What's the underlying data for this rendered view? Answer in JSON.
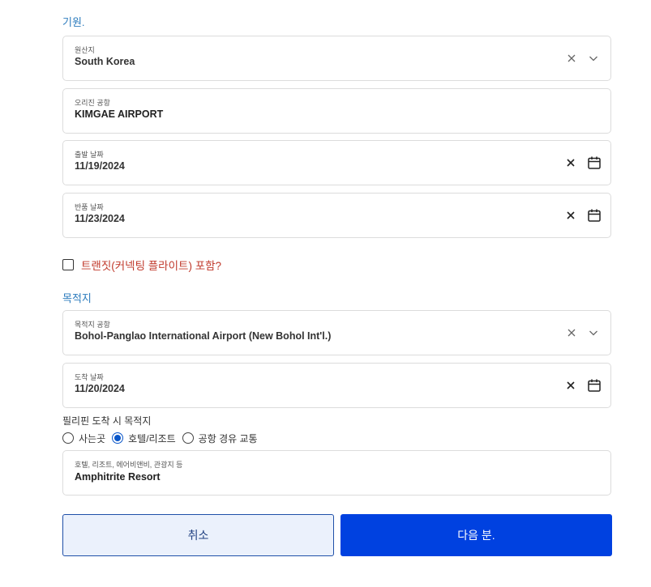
{
  "origin": {
    "section_title": "기원.",
    "country": {
      "label": "원산지",
      "value": "South Korea"
    },
    "airport": {
      "label": "오리진 공항",
      "value": "KIMGAE AIRPORT"
    },
    "departure": {
      "label": "출발 날짜",
      "value": "11/19/2024"
    },
    "return": {
      "label": "반품 날짜",
      "value": "11/23/2024"
    }
  },
  "transit": {
    "label": "트랜짓(커넥팅 플라이트) 포함?",
    "checked": false
  },
  "destination": {
    "section_title": "목적지",
    "airport": {
      "label": "목적지 공항",
      "value": "Bohol-Panglao International Airport (New Bohol Int'l.)"
    },
    "arrival": {
      "label": "도착 날짜",
      "value": "11/20/2024"
    },
    "question": "필리핀 도착 시 목적지",
    "options": [
      {
        "label": "사는곳",
        "checked": false
      },
      {
        "label": "호텔/리조트",
        "checked": true
      },
      {
        "label": "공항 경유 교통",
        "checked": false
      }
    ],
    "hotel": {
      "label": "호텔, 리조트, 에어비앤비, 관광지 등",
      "value": "Amphitrite Resort"
    }
  },
  "buttons": {
    "cancel": "취소",
    "next": "다음 분."
  },
  "colors": {
    "section_title": "#2b7bbd",
    "transit_label": "#c0392b",
    "primary": "#0041e0",
    "radio_selected": "#0a56c9"
  },
  "icons": [
    "clear-icon",
    "chevron-down-icon",
    "calendar-icon"
  ]
}
